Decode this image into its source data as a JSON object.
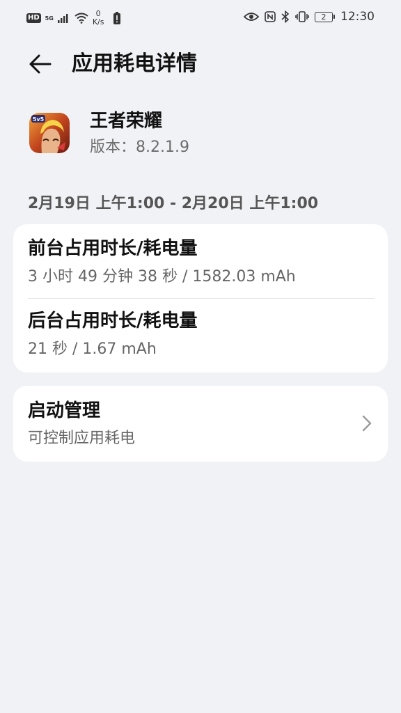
{
  "status_bar": {
    "hd": "HD",
    "network": "5G",
    "net_speed_value": "0",
    "net_speed_unit": "K/s",
    "battery_level": "2",
    "time": "12:30"
  },
  "header": {
    "title": "应用耗电详情"
  },
  "app": {
    "name": "王者荣耀",
    "version": "版本：8.2.1.9",
    "icon_badge": "5v5"
  },
  "date_range": "2月19日 上午1:00 - 2月20日 上午1:00",
  "usage": {
    "foreground_title": "前台占用时长/耗电量",
    "foreground_value": "3 小时 49 分钟 38 秒 / 1582.03 mAh",
    "background_title": "后台占用时长/耗电量",
    "background_value": "21 秒 / 1.67 mAh"
  },
  "launch": {
    "title": "启动管理",
    "subtitle": "可控制应用耗电"
  }
}
